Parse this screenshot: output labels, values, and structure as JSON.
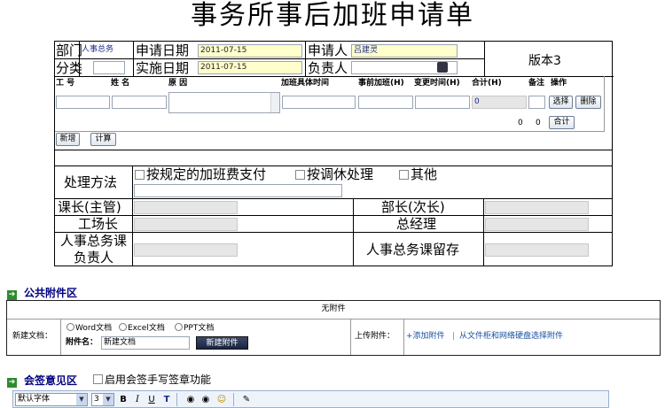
{
  "page_title": "事务所事后加班申请单",
  "header": {
    "dept_label": "部门",
    "dept_value": "人事总务",
    "apply_date_label": "申请日期",
    "apply_date_value": "2011-07-15",
    "applicant_label": "申请人",
    "applicant_value": "吕建灵",
    "version": "版本3",
    "category_label": "分类",
    "category_value": "",
    "exec_date_label": "实施日期",
    "exec_date_value": "2011-07-15",
    "owner_label": "负责人",
    "owner_value": ""
  },
  "table": {
    "columns": [
      "工 号",
      "姓 名",
      "原 因",
      "加班具体时间",
      "事前加班(H)",
      "变更时间(H)",
      "合计(H)",
      "备注",
      "操作"
    ],
    "row": {
      "emp_no": "",
      "name": "",
      "reason": "",
      "time": "",
      "pre_hours": "",
      "change_hours": "",
      "total": "0",
      "note": ""
    },
    "select_btn": "选择",
    "delete_btn": "删除",
    "sum_a": "0",
    "sum_b": "0",
    "sum_btn": "合计",
    "add_btn": "新增",
    "calc_btn": "计算"
  },
  "method": {
    "label": "处理方法",
    "option1": "按规定的加班费支付",
    "option2": "按调休处理",
    "option3": "其他",
    "other_text": ""
  },
  "approvals": {
    "section_chief": "课长(主管)",
    "dept_head": "部长(次长)",
    "factory_head": "工场长",
    "general_manager": "总经理",
    "hr_owner": "人事总务课负责人",
    "hr_archive": "人事总务课留存"
  },
  "attachments": {
    "section_title": "公共附件区",
    "none_text": "无附件",
    "new_doc_label": "新建文档：",
    "word": "Word文档",
    "excel": "Excel文档",
    "ppt": "PPT文档",
    "name_label": "附件名：",
    "name_value": "新建文档",
    "new_attach_btn": "新建附件",
    "upload_label": "上传附件：",
    "add_link": "+添加附件",
    "sep": "|",
    "cabinet_link": "从文件柜和网络硬盘选择附件"
  },
  "countersign": {
    "section_title": "会签意见区",
    "handwriting_label": "启用会签手写签章功能",
    "font_value": "默认字体",
    "size_value": "3",
    "bold": "B",
    "italic": "I",
    "underline": "U",
    "color": "T"
  },
  "colors": {
    "header_blue": "#000080",
    "input_yellow": "#ffffcc",
    "link_blue": "#1a4fa0",
    "section_arrow": "#2e8b2e"
  }
}
